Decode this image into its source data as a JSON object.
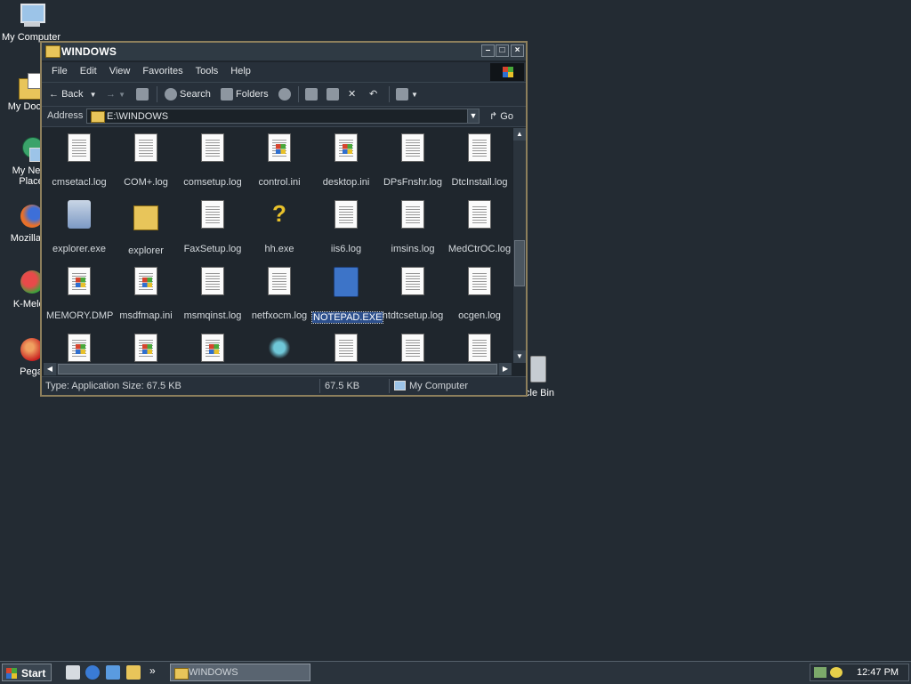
{
  "desktop": {
    "icons": [
      {
        "label": "My Computer",
        "icon": "my-computer-icon"
      },
      {
        "label": "My Docum",
        "icon": "my-documents-icon"
      },
      {
        "label": "My Netw Place",
        "icon": "network-places-icon"
      },
      {
        "label": "Mozilla Fi",
        "icon": "firefox-icon"
      },
      {
        "label": "K-Melec",
        "icon": "k-meleon-icon"
      },
      {
        "label": "Pega",
        "icon": "pegasus-icon"
      }
    ],
    "recycle_label": "cle Bin"
  },
  "window": {
    "title": "WINDOWS",
    "menu": [
      "File",
      "Edit",
      "View",
      "Favorites",
      "Tools",
      "Help"
    ],
    "toolbar": {
      "back": "Back",
      "search": "Search",
      "folders": "Folders"
    },
    "address": {
      "label": "Address",
      "value": "E:\\WINDOWS",
      "go": "Go"
    },
    "files": [
      {
        "name": "cmsetacl.log",
        "type": "doc"
      },
      {
        "name": "COM+.log",
        "type": "doc"
      },
      {
        "name": "comsetup.log",
        "type": "doc"
      },
      {
        "name": "control.ini",
        "type": "ini"
      },
      {
        "name": "desktop.ini",
        "type": "ini"
      },
      {
        "name": "DPsFnshr.log",
        "type": "doc"
      },
      {
        "name": "DtcInstall.log",
        "type": "doc"
      },
      {
        "name": "explorer.exe",
        "type": "exe-explorer"
      },
      {
        "name": "explorer",
        "type": "folder-search"
      },
      {
        "name": "FaxSetup.log",
        "type": "doc"
      },
      {
        "name": "hh.exe",
        "type": "help"
      },
      {
        "name": "iis6.log",
        "type": "doc"
      },
      {
        "name": "imsins.log",
        "type": "doc"
      },
      {
        "name": "MedCtrOC.log",
        "type": "doc"
      },
      {
        "name": "MEMORY.DMP",
        "type": "ini"
      },
      {
        "name": "msdfmap.ini",
        "type": "ini"
      },
      {
        "name": "msmqinst.log",
        "type": "doc"
      },
      {
        "name": "netfxocm.log",
        "type": "doc"
      },
      {
        "name": "NOTEPAD.EXE",
        "type": "notepad",
        "selected": true
      },
      {
        "name": "ntdtcsetup.log",
        "type": "doc"
      },
      {
        "name": "ocgen.log",
        "type": "doc"
      },
      {
        "name": "",
        "type": "ini"
      },
      {
        "name": "",
        "type": "ini"
      },
      {
        "name": "",
        "type": "ini"
      },
      {
        "name": "",
        "type": "sparkle"
      },
      {
        "name": "",
        "type": "doc"
      },
      {
        "name": "",
        "type": "doc"
      },
      {
        "name": "",
        "type": "doc"
      }
    ],
    "status": {
      "info": "Type: Application Size: 67.5 KB",
      "size": "67.5 KB",
      "zone": "My Computer"
    }
  },
  "taskbar": {
    "start": "Start",
    "task": "WINDOWS",
    "clock": "12:47 PM",
    "overflow": "»"
  }
}
